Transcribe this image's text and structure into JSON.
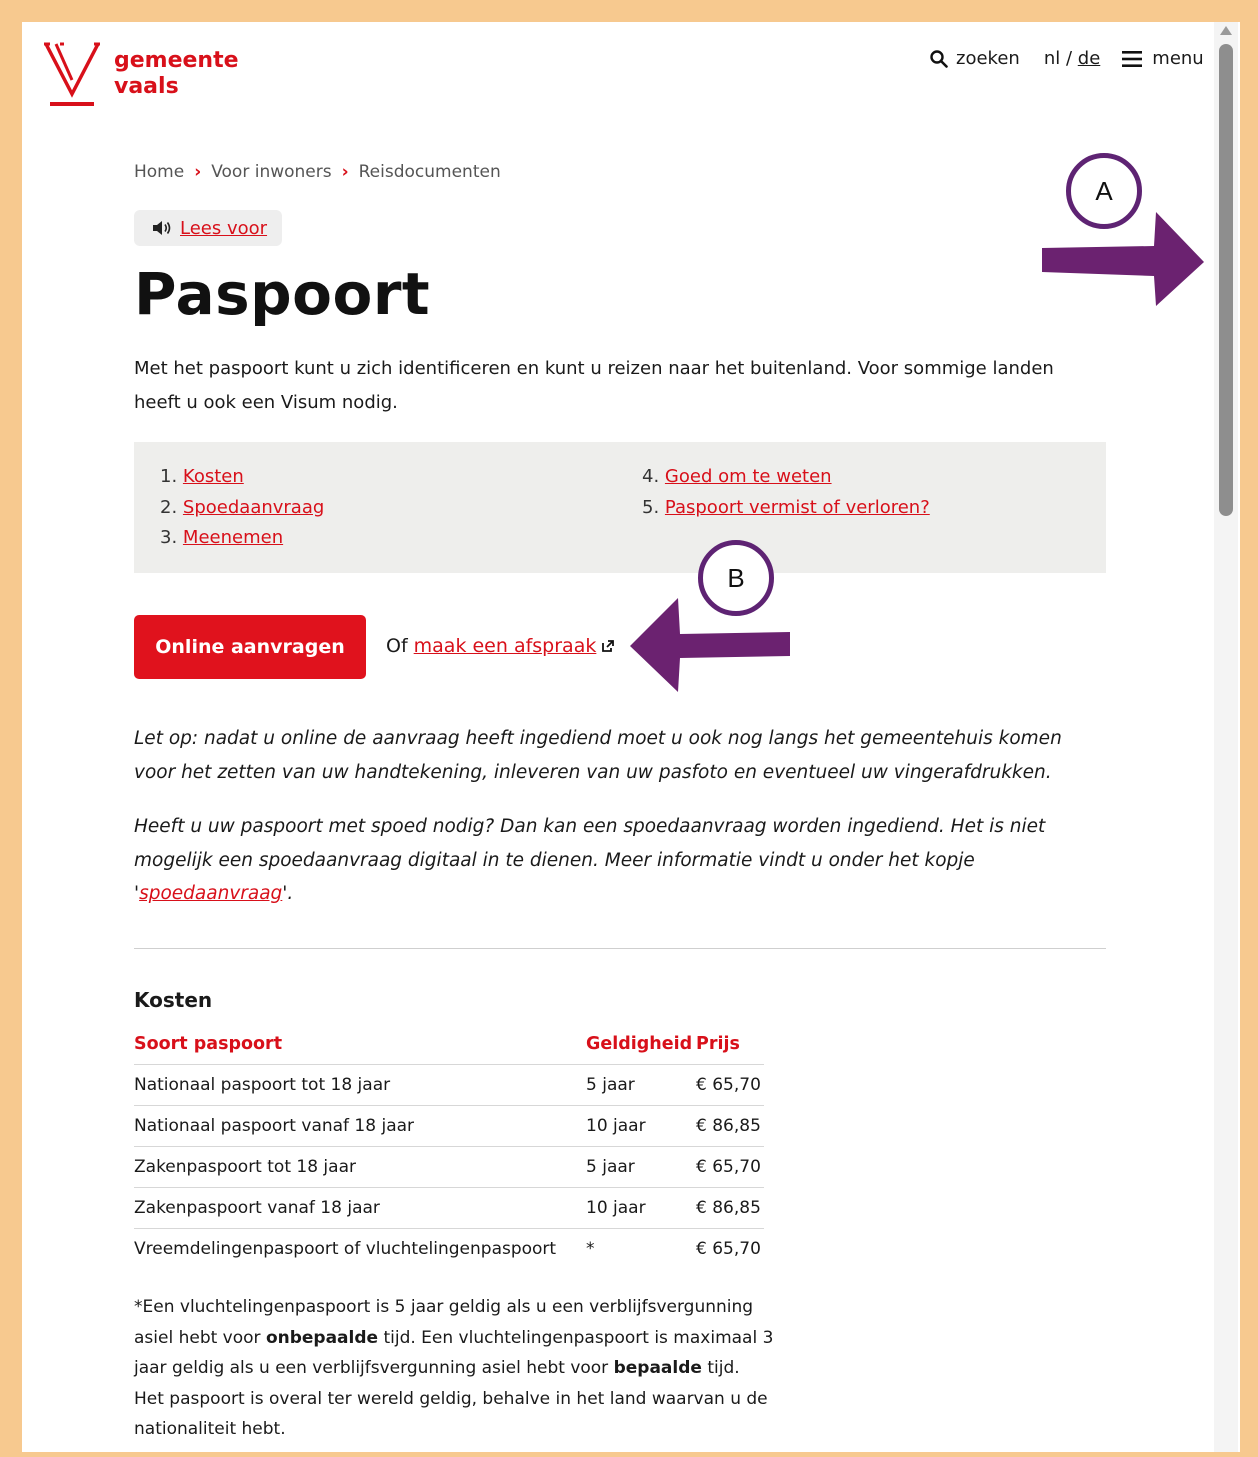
{
  "header": {
    "logo_line1": "gemeente",
    "logo_line2": "vaals",
    "search_label": "zoeken",
    "lang_current": "nl",
    "lang_separator": "/",
    "lang_other": "de",
    "menu_label": "menu"
  },
  "breadcrumb": [
    "Home",
    "Voor inwoners",
    "Reisdocumenten"
  ],
  "read_aloud": "Lees voor",
  "title": "Paspoort",
  "intro": "Met het paspoort  kunt u zich identificeren en kunt u reizen naar het buitenland. Voor sommige landen heeft u ook een Visum nodig.",
  "toc": [
    {
      "num": "1.",
      "label": "Kosten"
    },
    {
      "num": "2.",
      "label": "Spoedaanvraag"
    },
    {
      "num": "3.",
      "label": "Meenemen"
    },
    {
      "num": "4.",
      "label": "Goed om te weten"
    },
    {
      "num": "5.",
      "label": "Paspoort vermist of verloren?"
    }
  ],
  "cta": {
    "button": "Online aanvragen",
    "or_text": "Of",
    "appointment_link": "maak een afspraak"
  },
  "notes": {
    "note1": "Let op: nadat u online de aanvraag heeft ingediend moet u ook nog langs het gemeentehuis komen voor het zetten van uw handtekening, inleveren van uw pasfoto en eventueel uw vingerafdrukken.",
    "note2_before": "Heeft u uw paspoort met spoed nodig? Dan kan een spoedaanvraag worden ingediend. Het is niet mogelijk een spoedaanvraag digitaal in te dienen. Meer informatie vindt u onder het kopje '",
    "note2_link": "spoedaanvraag",
    "note2_after": "'."
  },
  "costs": {
    "heading": "Kosten",
    "columns": [
      "Soort paspoort",
      "Geldigheid",
      "Prijs"
    ],
    "rows": [
      [
        "Nationaal paspoort tot 18 jaar",
        "5 jaar",
        "€ 65,70"
      ],
      [
        "Nationaal paspoort vanaf 18 jaar",
        "10 jaar",
        "€ 86,85"
      ],
      [
        "Zakenpaspoort tot 18 jaar",
        "5 jaar",
        "€ 65,70"
      ],
      [
        "Zakenpaspoort vanaf 18 jaar",
        "10 jaar",
        "€ 86,85"
      ],
      [
        "Vreemdelingenpaspoort of vluchtelingenpaspoort",
        "*",
        "€ 65,70"
      ]
    ],
    "footnote_1": "*Een vluchtelingenpaspoort is 5 jaar geldig als u een verblijfsvergunning asiel hebt voor ",
    "footnote_bold1": "onbepaalde",
    "footnote_2": " tijd. Een vluchtelingenpaspoort is maximaal 3 jaar geldig als u een verblijfsvergunning asiel hebt voor ",
    "footnote_bold2": "bepaalde",
    "footnote_3": " tijd. Het paspoort is overal ter wereld geldig, behalve in het land waarvan u de nationaliteit hebt."
  },
  "annotations": {
    "a": "A",
    "b": "B"
  },
  "colors": {
    "brand_red": "#e0121d",
    "annotation_purple": "#6b2270",
    "frame": "#f7c98f"
  }
}
